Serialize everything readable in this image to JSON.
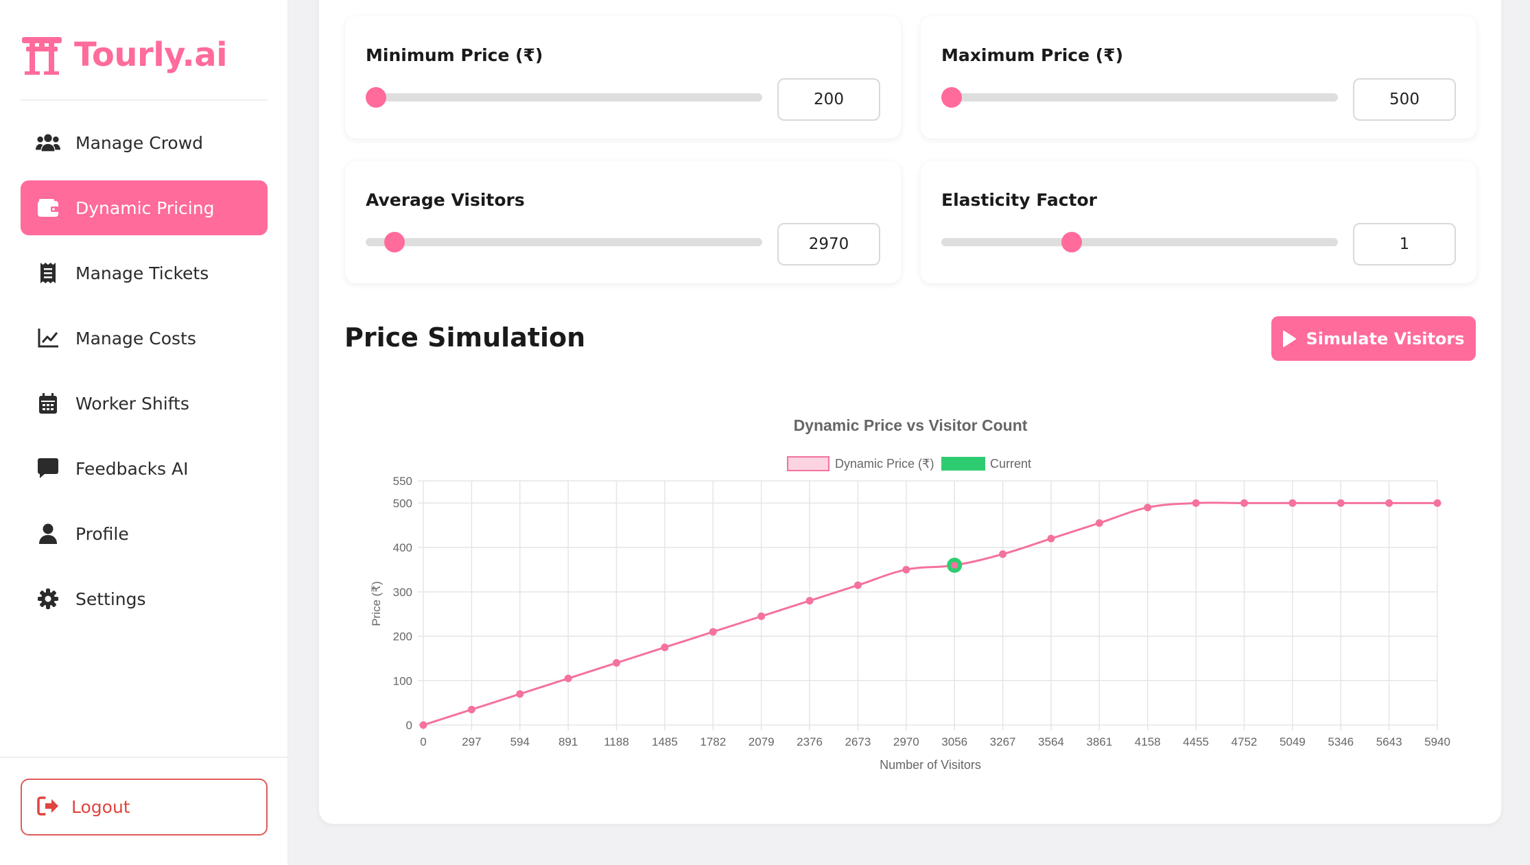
{
  "brand": {
    "name": "Tourly.ai",
    "color": "#ff6b9b"
  },
  "sidebar": {
    "items": [
      {
        "label": "Manage Crowd",
        "icon": "users-icon",
        "active": false
      },
      {
        "label": "Dynamic Pricing",
        "icon": "wallet-icon",
        "active": true
      },
      {
        "label": "Manage Tickets",
        "icon": "receipt-icon",
        "active": false
      },
      {
        "label": "Manage Costs",
        "icon": "chart-line-icon",
        "active": false
      },
      {
        "label": "Worker Shifts",
        "icon": "calendar-icon",
        "active": false
      },
      {
        "label": "Feedbacks AI",
        "icon": "comment-icon",
        "active": false
      },
      {
        "label": "Profile",
        "icon": "user-icon",
        "active": false
      },
      {
        "label": "Settings",
        "icon": "gear-icon",
        "active": false
      }
    ],
    "logout_label": "Logout"
  },
  "controls": {
    "min_price": {
      "label": "Minimum Price (₹)",
      "value": "200",
      "slider_fraction": 0.0
    },
    "max_price": {
      "label": "Maximum Price (₹)",
      "value": "500",
      "slider_fraction": 0.0
    },
    "avg_visitors": {
      "label": "Average Visitors",
      "value": "2970",
      "slider_fraction": 0.05
    },
    "elasticity": {
      "label": "Elasticity Factor",
      "value": "1",
      "slider_fraction": 0.32
    }
  },
  "simulation": {
    "title": "Price Simulation",
    "button_label": "Simulate Visitors"
  },
  "colors": {
    "accent": "#ff6b9b",
    "current": "#2ecc71",
    "danger": "#e0443e"
  },
  "chart_data": {
    "type": "line",
    "title": "Dynamic Price vs Visitor Count",
    "xlabel": "Number of Visitors",
    "ylabel": "Price (₹)",
    "ylim": [
      0,
      550
    ],
    "yticks": [
      0,
      100,
      200,
      300,
      400,
      500,
      550
    ],
    "grid": true,
    "legend_position": "top",
    "categories": [
      "0",
      "297",
      "594",
      "891",
      "1188",
      "1485",
      "1782",
      "2079",
      "2376",
      "2673",
      "2970",
      "3056",
      "3267",
      "3564",
      "3861",
      "4158",
      "4455",
      "4752",
      "5049",
      "5346",
      "5643",
      "5940"
    ],
    "series": [
      {
        "name": "Dynamic Price (₹)",
        "color": "#f4729b",
        "values": [
          0,
          35,
          70,
          105,
          140,
          175,
          210,
          245,
          280,
          315,
          350,
          360,
          385,
          420,
          455,
          490,
          500,
          500,
          500,
          500,
          500,
          500
        ]
      },
      {
        "name": "Current",
        "color": "#2ecc71",
        "point": {
          "category": "3056",
          "value": 360
        }
      }
    ]
  }
}
